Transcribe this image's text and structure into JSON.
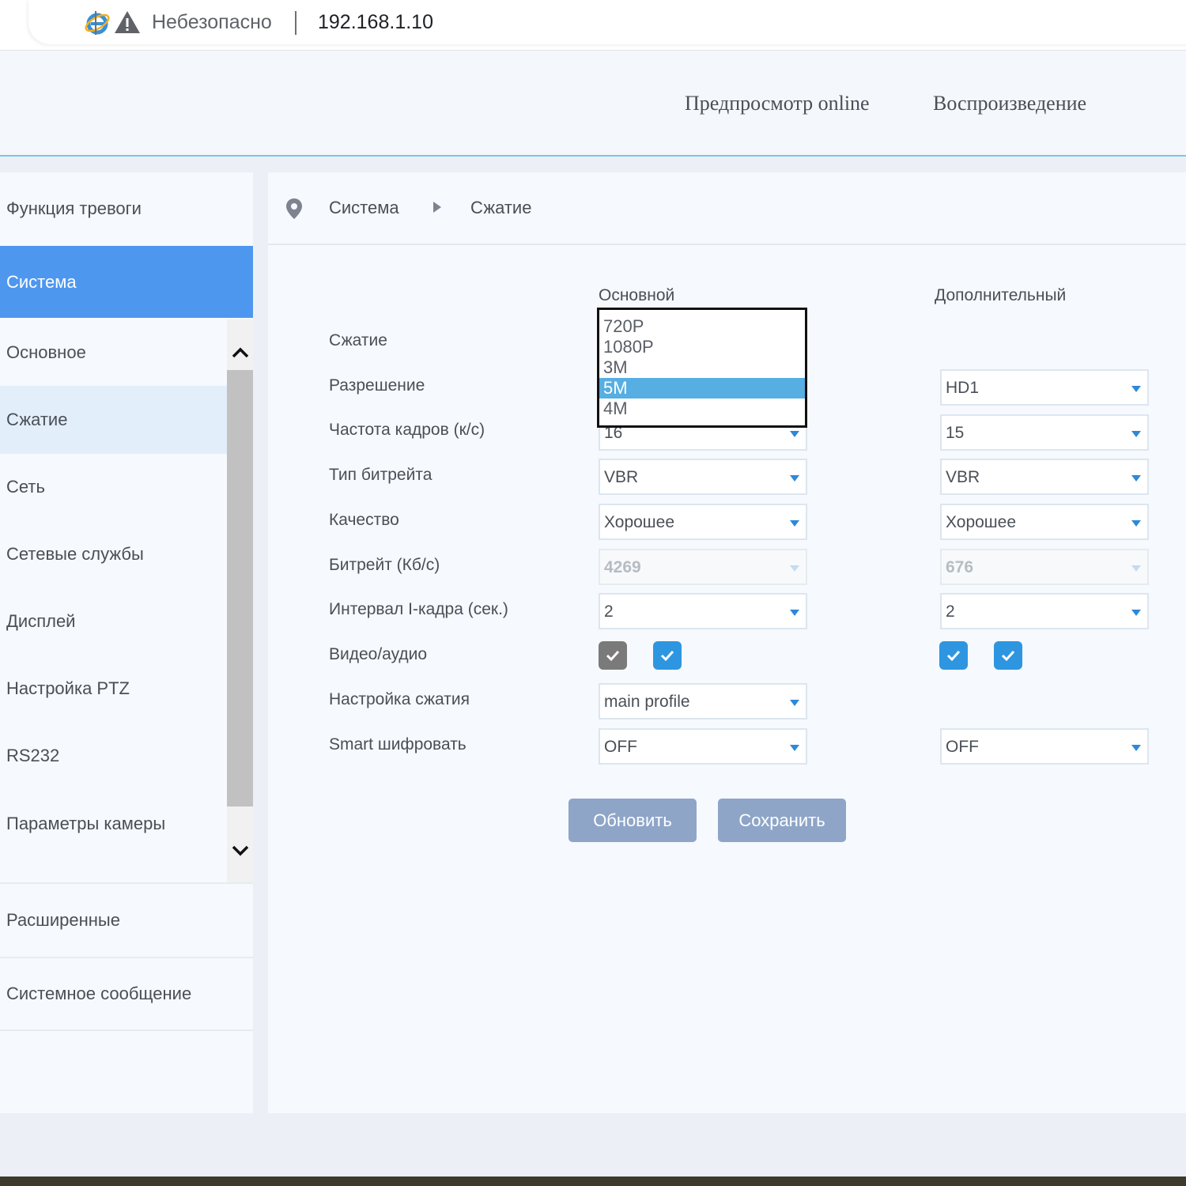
{
  "browser": {
    "security_warning": "Небезопасно",
    "url": "192.168.1.10"
  },
  "header": {
    "nav": [
      "Предпросмотр online",
      "Воспроизведение"
    ]
  },
  "sidebar": {
    "items": [
      {
        "label": "Функция тревоги"
      },
      {
        "label": "Система"
      },
      {
        "label": "Основное"
      },
      {
        "label": "Сжатие"
      },
      {
        "label": "Сеть"
      },
      {
        "label": "Сетевые службы"
      },
      {
        "label": "Дисплей"
      },
      {
        "label": "Настройка PTZ"
      },
      {
        "label": "RS232"
      },
      {
        "label": "Параметры камеры"
      },
      {
        "label": "Расширенные"
      },
      {
        "label": "Системное сообщение"
      }
    ]
  },
  "breadcrumb": {
    "section": "Система",
    "page": "Сжатие"
  },
  "form": {
    "col_main": "Основной",
    "col_extra": "Дополнительный",
    "labels": {
      "compression": "Сжатие",
      "resolution": "Разрешение",
      "fps": "Частота кадров (к/с)",
      "bitrate_type": "Тип битрейта",
      "quality": "Качество",
      "bitrate": "Битрейт (Кб/с)",
      "iframe": "Интервал I-кадра (сек.)",
      "video_audio": "Видео/аудио",
      "compression_setting": "Настройка сжатия",
      "smart_encrypt": "Smart шифровать"
    },
    "main": {
      "fps": "16",
      "bitrate_type": "VBR",
      "quality": "Хорошее",
      "bitrate": "4269",
      "iframe": "2",
      "compression_setting": "main profile",
      "smart_encrypt": "OFF",
      "video_checked": true,
      "audio_checked": true
    },
    "extra": {
      "resolution": "HD1",
      "fps": "15",
      "bitrate_type": "VBR",
      "quality": "Хорошее",
      "bitrate": "676",
      "iframe": "2",
      "smart_encrypt": "OFF",
      "video_checked": true,
      "audio_checked": true
    },
    "resolution_dropdown": {
      "options": [
        "720P",
        "1080P",
        "3M",
        "5M",
        "4M"
      ],
      "selected": "5M"
    }
  },
  "buttons": {
    "refresh": "Обновить",
    "save": "Сохранить"
  },
  "colors": {
    "accent": "#4e97ef",
    "checkbox_blue": "#2e96e0",
    "checkbox_gray": "#7a7a7a",
    "button": "#8ea5c8",
    "dropdown_highlight": "#56aee2"
  }
}
